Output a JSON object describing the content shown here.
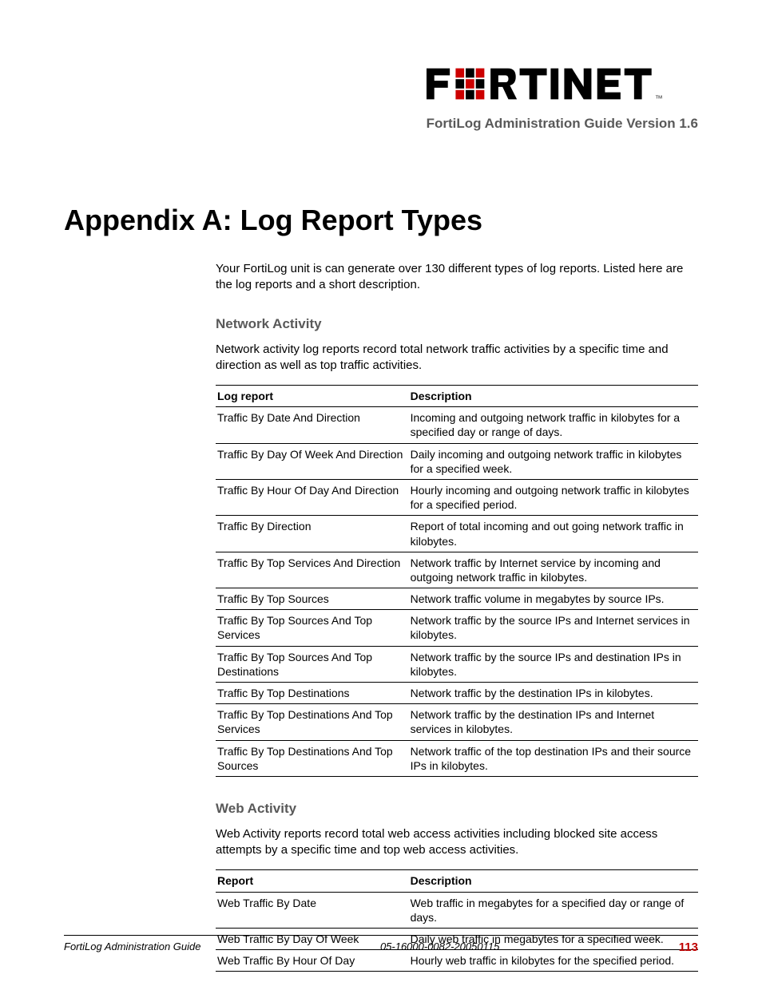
{
  "header": {
    "subtitle": "FortiLog Administration Guide Version 1.6"
  },
  "title": "Appendix A: Log Report Types",
  "intro": "Your FortiLog unit is can generate over 130 different types of log reports. Listed here are the log reports and a short description.",
  "section1": {
    "heading": "Network Activity",
    "intro": "Network activity log reports record total network traffic activities by a specific time and direction as well as top traffic activities.",
    "th1": "Log report",
    "th2": "Description",
    "rows": [
      {
        "c1": "Traffic By Date And Direction",
        "c2": "Incoming and outgoing network traffic in kilobytes for a specified day or range of days."
      },
      {
        "c1": "Traffic By Day Of Week And Direction",
        "c2": "Daily incoming and outgoing network traffic in kilobytes for a specified week."
      },
      {
        "c1": "Traffic By Hour Of Day And Direction",
        "c2": "Hourly incoming and outgoing network traffic in kilobytes for a specified period."
      },
      {
        "c1": "Traffic By Direction",
        "c2": "Report of total incoming and out going network traffic in kilobytes."
      },
      {
        "c1": "Traffic By Top Services And Direction",
        "c2": "Network traffic by Internet service by incoming and outgoing network traffic in kilobytes."
      },
      {
        "c1": "Traffic By Top Sources",
        "c2": "Network traffic volume in megabytes by source IPs."
      },
      {
        "c1": "Traffic By Top Sources And Top Services",
        "c2": "Network traffic by the source IPs and Internet services in kilobytes."
      },
      {
        "c1": "Traffic By Top Sources And Top Destinations",
        "c2": "Network traffic by the source IPs and destination IPs in kilobytes."
      },
      {
        "c1": "Traffic By Top Destinations",
        "c2": "Network traffic by the destination IPs in kilobytes."
      },
      {
        "c1": "Traffic By Top Destinations And Top Services",
        "c2": "Network traffic by the destination IPs and Internet services in kilobytes."
      },
      {
        "c1": "Traffic By Top Destinations And Top Sources",
        "c2": "Network traffic of the top destination IPs and their source IPs in kilobytes."
      }
    ]
  },
  "section2": {
    "heading": "Web Activity",
    "intro": "Web Activity reports record total web access activities including blocked site access attempts by a specific time and top web access activities.",
    "th1": "Report",
    "th2": "Description",
    "rows": [
      {
        "c1": "Web Traffic By Date",
        "c2": "Web traffic in megabytes for a specified day or range of days."
      },
      {
        "c1": "Web Traffic By Day Of Week",
        "c2": "Daily web traffic in megabytes for a specified week."
      },
      {
        "c1": "Web Traffic By Hour Of Day",
        "c2": "Hourly web traffic in kilobytes for the specified period."
      }
    ]
  },
  "footer": {
    "left": "FortiLog Administration Guide",
    "center": "05-16000-0082-20050115",
    "pagenum": "113"
  }
}
